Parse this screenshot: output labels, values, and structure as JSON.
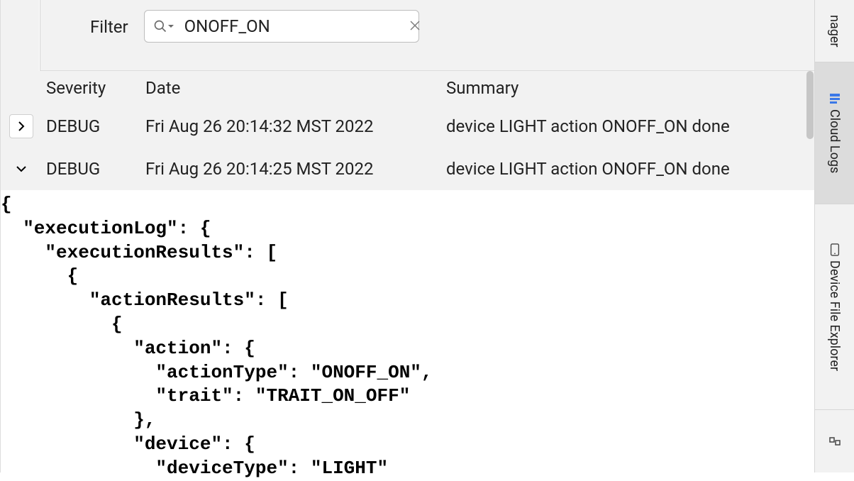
{
  "filter": {
    "label": "Filter",
    "value": "ONOFF_ON"
  },
  "columns": {
    "severity": "Severity",
    "date": "Date",
    "summary": "Summary"
  },
  "rows": [
    {
      "expanded": false,
      "severity": "DEBUG",
      "date": "Fri Aug 26 20:14:32 MST 2022",
      "summary": "device LIGHT action ONOFF_ON done"
    },
    {
      "expanded": true,
      "severity": "DEBUG",
      "date": "Fri Aug 26 20:14:25 MST 2022",
      "summary": "device LIGHT action ONOFF_ON done"
    }
  ],
  "json_detail": "{\n  \"executionLog\": {\n    \"executionResults\": [\n      {\n        \"actionResults\": [\n          {\n            \"action\": {\n              \"actionType\": \"ONOFF_ON\",\n              \"trait\": \"TRAIT_ON_OFF\"\n            },\n            \"device\": {\n              \"deviceType\": \"LIGHT\"",
  "rail": {
    "t0": "nager",
    "t1": "Cloud Logs",
    "t2": "Device File Explorer"
  }
}
